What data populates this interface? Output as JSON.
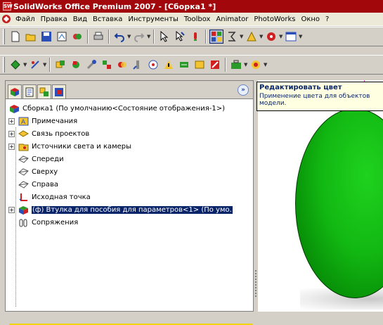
{
  "window": {
    "title": "SolidWorks Office Premium 2007 - [Сборка1 *]"
  },
  "menu": [
    "Файл",
    "Правка",
    "Вид",
    "Вставка",
    "Инструменты",
    "Toolbox",
    "Animator",
    "PhotoWorks",
    "Окно",
    "?"
  ],
  "tooltip": {
    "title": "Редактировать цвет",
    "body": "Применение цвета для объектов модели."
  },
  "tree": {
    "root": "Сборка1  (По умолчанию<Состояние отображения-1>)",
    "items": [
      {
        "label": "Примечания",
        "icon": "annotations-icon",
        "expandable": true
      },
      {
        "label": "Связь проектов",
        "icon": "design-binder-icon",
        "expandable": true
      },
      {
        "label": "Источники света и камеры",
        "icon": "lights-cameras-icon",
        "expandable": true
      },
      {
        "label": "Спереди",
        "icon": "plane-icon",
        "expandable": false
      },
      {
        "label": "Сверху",
        "icon": "plane-icon",
        "expandable": false
      },
      {
        "label": "Справа",
        "icon": "plane-icon",
        "expandable": false
      },
      {
        "label": "Исходная точка",
        "icon": "origin-icon",
        "expandable": false
      },
      {
        "label": "(ф) Втулка для пособия для параметров<1> (По умо.",
        "icon": "part-icon",
        "expandable": true,
        "selected": true
      },
      {
        "label": "Сопряжения",
        "icon": "mates-icon",
        "expandable": false
      }
    ]
  },
  "colors": {
    "titlebar": "#a1070b",
    "selection": "#0a246a",
    "model": "#12b812",
    "tooltip_bg": "#ffffe1"
  }
}
